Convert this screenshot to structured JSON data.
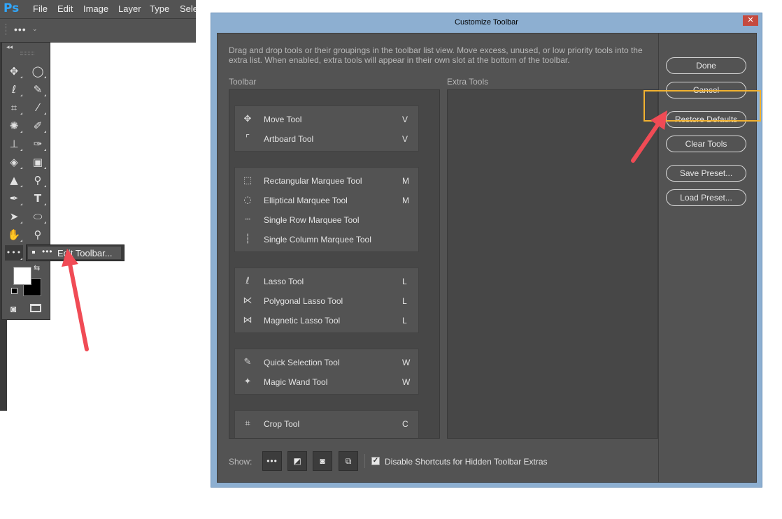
{
  "app": {
    "logo": "Ps",
    "menu": [
      "File",
      "Edit",
      "Image",
      "Layer",
      "Type",
      "Sele"
    ],
    "options_bar": {
      "icon": "ellipsis-icon"
    },
    "toolbar_collapse": "◂◂",
    "edit_toolbar_menu_label": "Edit Toolbar...",
    "accent": "#31a8ff"
  },
  "dialog": {
    "title": "Customize Toolbar",
    "close_label": "✕",
    "description": "Drag and drop tools or their groupings in the toolbar list view. Move excess, unused, or low priority tools into the extra list. When enabled, extra tools will appear in their own slot at the bottom of the toolbar.",
    "toolbar_header": "Toolbar",
    "extra_header": "Extra Tools",
    "groups": [
      {
        "tools": [
          {
            "name": "Move Tool",
            "key": "V",
            "icon": "move-icon"
          },
          {
            "name": "Artboard Tool",
            "key": "V",
            "icon": "artboard-icon"
          }
        ]
      },
      {
        "tools": [
          {
            "name": "Rectangular Marquee Tool",
            "key": "M",
            "icon": "rect-marquee-icon"
          },
          {
            "name": "Elliptical Marquee Tool",
            "key": "M",
            "icon": "ellipse-marquee-icon"
          },
          {
            "name": "Single Row Marquee Tool",
            "key": "",
            "icon": "single-row-marquee-icon"
          },
          {
            "name": "Single Column Marquee Tool",
            "key": "",
            "icon": "single-column-marquee-icon"
          }
        ]
      },
      {
        "tools": [
          {
            "name": "Lasso Tool",
            "key": "L",
            "icon": "lasso-icon"
          },
          {
            "name": "Polygonal Lasso Tool",
            "key": "L",
            "icon": "polygonal-lasso-icon"
          },
          {
            "name": "Magnetic Lasso Tool",
            "key": "L",
            "icon": "magnetic-lasso-icon"
          }
        ]
      },
      {
        "tools": [
          {
            "name": "Quick Selection Tool",
            "key": "W",
            "icon": "quick-selection-icon"
          },
          {
            "name": "Magic Wand Tool",
            "key": "W",
            "icon": "magic-wand-icon"
          }
        ]
      },
      {
        "tools": [
          {
            "name": "Crop Tool",
            "key": "C",
            "icon": "crop-icon"
          }
        ]
      }
    ],
    "buttons": {
      "done": "Done",
      "cancel": "Cancel",
      "restore": "Restore Defaults",
      "clear": "Clear Tools",
      "save_preset": "Save Preset...",
      "load_preset": "Load Preset..."
    },
    "show_label": "Show:",
    "disable_shortcuts_label": "Disable Shortcuts for Hidden Toolbar Extras",
    "disable_shortcuts_checked": true,
    "highlight_color": "#f2b230",
    "arrow_color": "#f04b55"
  }
}
